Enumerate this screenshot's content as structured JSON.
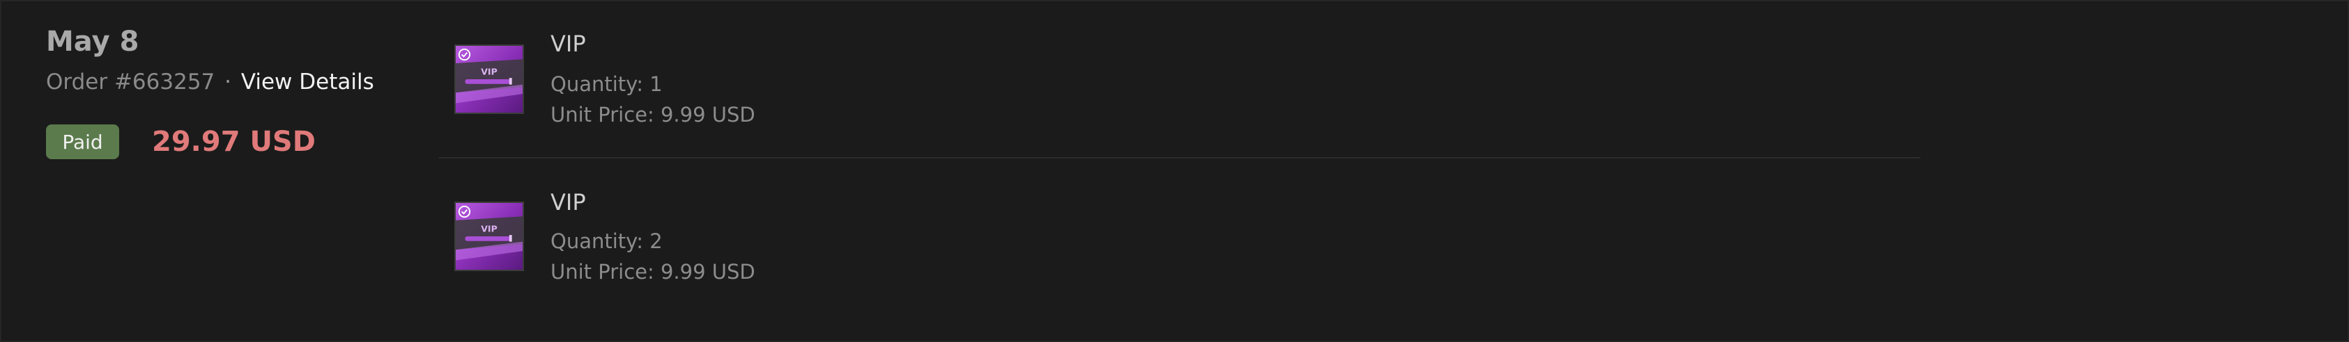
{
  "order": {
    "date": "May 8",
    "order_number": "Order #663257",
    "separator": "·",
    "view_details_label": "View Details",
    "status": "Paid",
    "total": "29.97 USD"
  },
  "items": [
    {
      "title": "VIP",
      "quantity": "Quantity: 1",
      "unit_price": "Unit Price: 9.99 USD",
      "thumbnail_text": "VIP",
      "thumbnail_icon": "check-badge-icon"
    },
    {
      "title": "VIP",
      "quantity": "Quantity: 2",
      "unit_price": "Unit Price: 9.99 USD",
      "thumbnail_text": "VIP",
      "thumbnail_icon": "check-badge-icon"
    }
  ],
  "colors": {
    "background": "#1b1b1b",
    "paid_badge": "#5b7b4c",
    "total": "#e07a7a",
    "thumbnail_purple": "#9b3fc7"
  }
}
